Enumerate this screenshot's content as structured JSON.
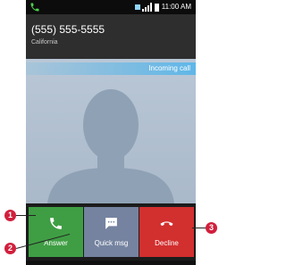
{
  "status": {
    "time": "11:00 AM"
  },
  "caller": {
    "number": "(555) 555-5555",
    "location": "California"
  },
  "incoming_label": "Incoming call",
  "buttons": {
    "answer": "Answer",
    "quick": "Quick msg",
    "decline": "Decline"
  },
  "callouts": [
    "1",
    "2",
    "3"
  ],
  "colors": {
    "answer": "#3f9e44",
    "quick": "#7583a0",
    "decline": "#d22f2f",
    "callout": "#d11f3c",
    "incoming_bar": "#50b4eb"
  }
}
